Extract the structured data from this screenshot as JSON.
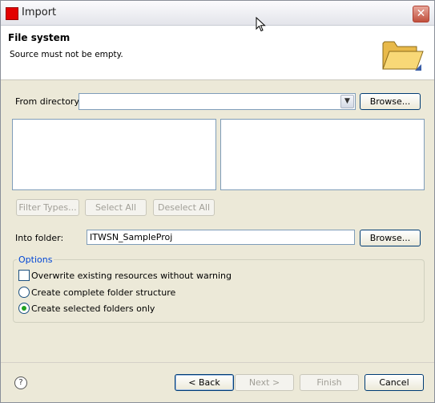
{
  "window": {
    "title": "Import"
  },
  "banner": {
    "title": "File system",
    "message": "Source must not be empty."
  },
  "from_directory": {
    "label": "From directory:",
    "value": "",
    "browse_label": "Browse..."
  },
  "selection_buttons": {
    "filter_types": "Filter Types...",
    "select_all": "Select All",
    "deselect_all": "Deselect All"
  },
  "into_folder": {
    "label": "Into folder:",
    "value": "ITWSN_SampleProj",
    "browse_label": "Browse..."
  },
  "options": {
    "group_label": "Options",
    "overwrite": {
      "label": "Overwrite existing resources without warning",
      "checked": false
    },
    "complete_structure": {
      "label": "Create complete folder structure",
      "selected": false
    },
    "selected_only": {
      "label": "Create selected folders only",
      "selected": true
    }
  },
  "footer": {
    "back": "< Back",
    "next": "Next >",
    "finish": "Finish",
    "cancel": "Cancel",
    "help_glyph": "?"
  },
  "colors": {
    "title_close": "#c0503d",
    "group_label": "#0046d5",
    "radio_selected": "#21a121"
  }
}
